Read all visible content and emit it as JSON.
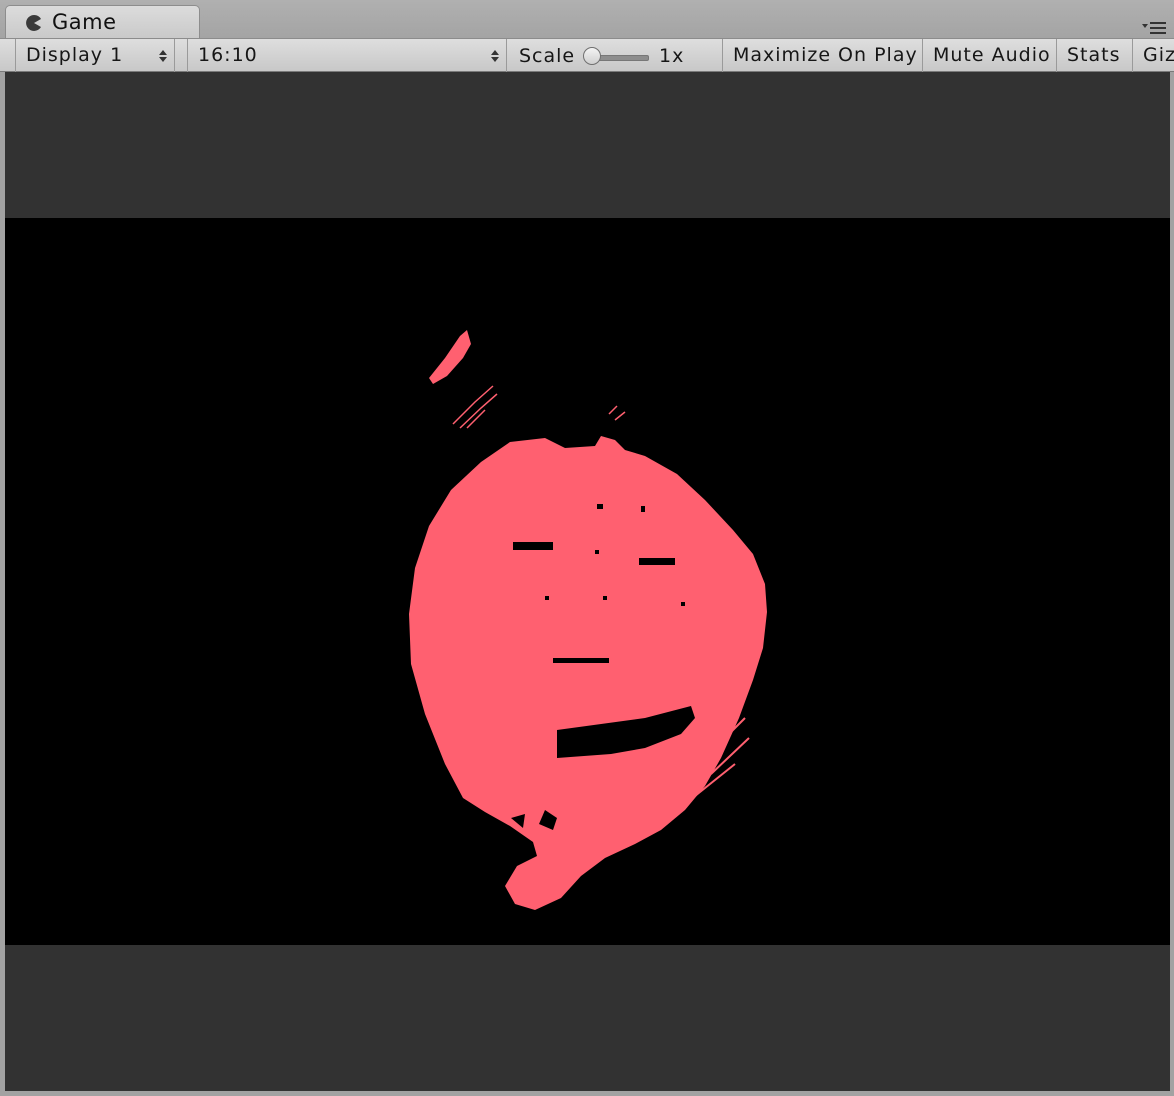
{
  "window": {
    "tab_title": "Game",
    "tab_icon": "pacman-game-icon",
    "menu_icon": "tab-menu-icon"
  },
  "toolbar": {
    "display_select": "Display 1",
    "aspect_select": "16:10",
    "scale_label": "Scale",
    "scale_value": "1x",
    "maximize_on_play": "Maximize On Play",
    "mute_audio": "Mute Audio",
    "stats": "Stats",
    "gizmos": "Gizmos"
  },
  "colors": {
    "viewport_background": "#323232",
    "game_background": "#000000",
    "segmentation_mask": "#ff6070"
  }
}
